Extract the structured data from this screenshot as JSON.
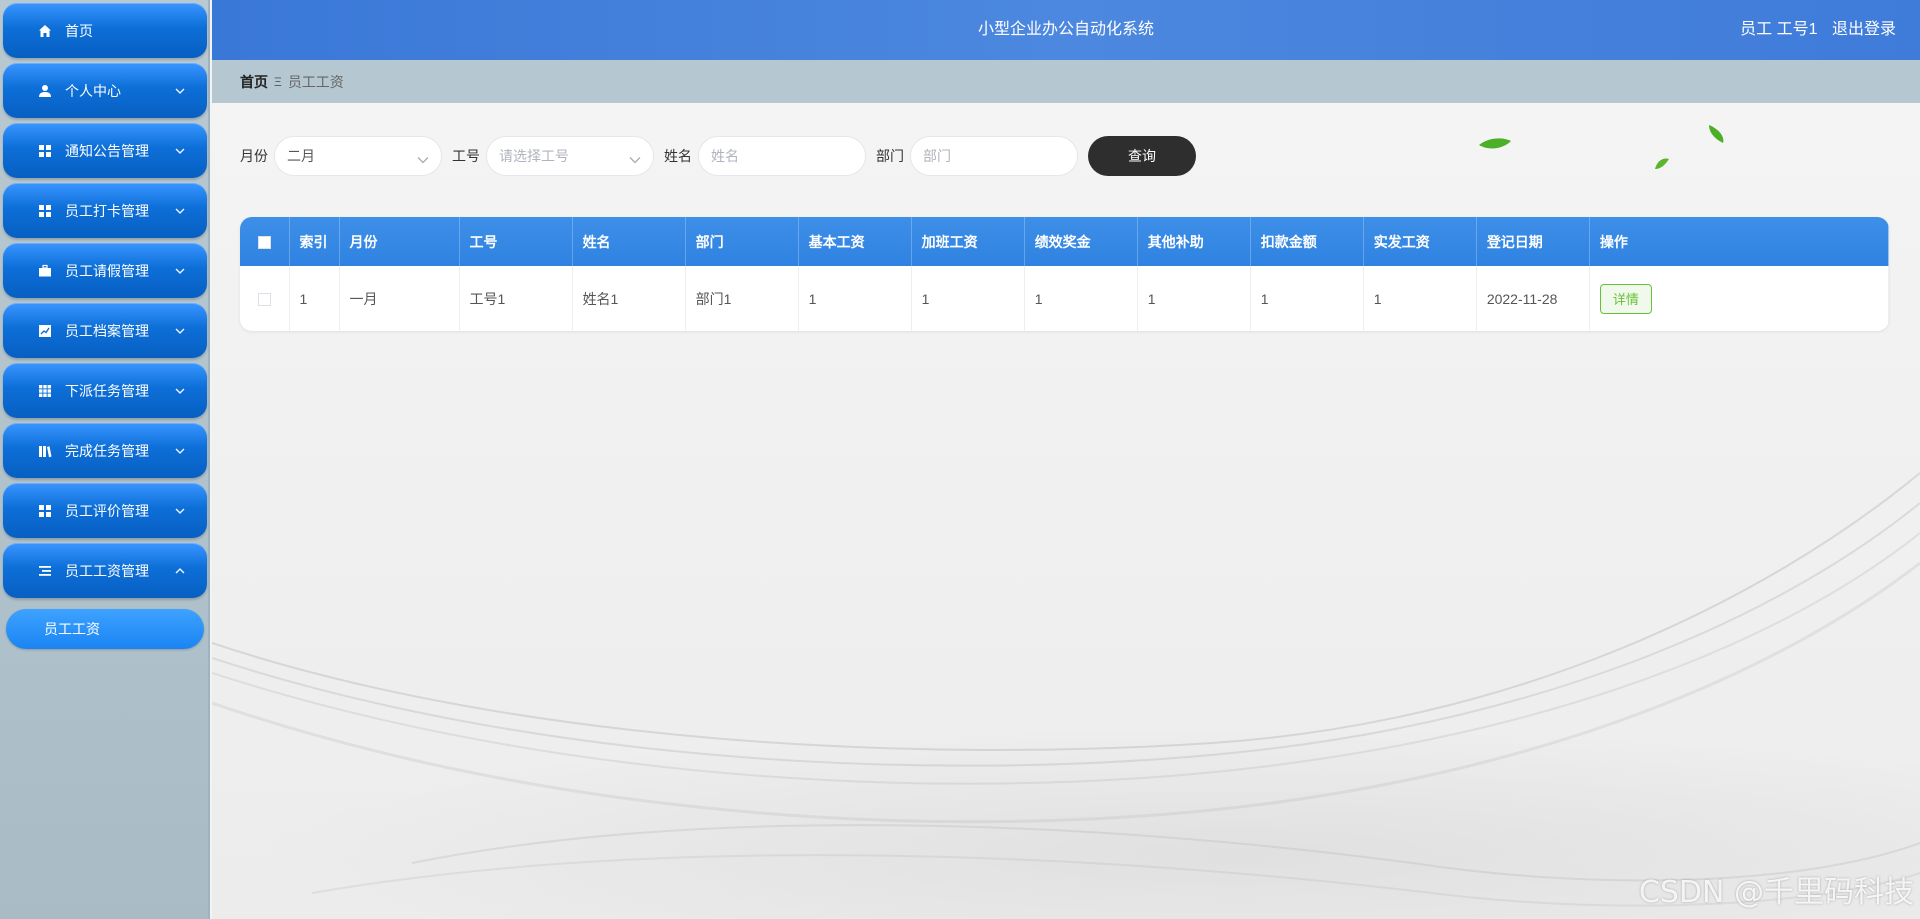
{
  "header": {
    "title": "小型企业办公自动化系统",
    "user": "员工 工号1",
    "logout": "退出登录"
  },
  "sidebar": {
    "items": [
      {
        "label": "首页",
        "icon": "home-icon",
        "expandable": false
      },
      {
        "label": "个人中心",
        "icon": "user-icon",
        "expandable": true
      },
      {
        "label": "通知公告管理",
        "icon": "grid-icon",
        "expandable": true
      },
      {
        "label": "员工打卡管理",
        "icon": "grid-icon",
        "expandable": true
      },
      {
        "label": "员工请假管理",
        "icon": "briefcase-icon",
        "expandable": true
      },
      {
        "label": "员工档案管理",
        "icon": "chart-icon",
        "expandable": true
      },
      {
        "label": "下派任务管理",
        "icon": "table-icon",
        "expandable": true
      },
      {
        "label": "完成任务管理",
        "icon": "library-icon",
        "expandable": true
      },
      {
        "label": "员工评价管理",
        "icon": "grid-icon",
        "expandable": true
      },
      {
        "label": "员工工资管理",
        "icon": "list-icon",
        "expandable": true,
        "expanded": true
      }
    ],
    "submenu": {
      "label": "员工工资"
    }
  },
  "breadcrumb": {
    "home": "首页",
    "separator": "Ξ",
    "current": "员工工资"
  },
  "search": {
    "month_label": "月份",
    "month_value": "二月",
    "empno_label": "工号",
    "empno_placeholder": "请选择工号",
    "name_label": "姓名",
    "name_placeholder": "姓名",
    "dept_label": "部门",
    "dept_placeholder": "部门",
    "button": "查询"
  },
  "table": {
    "columns": [
      "索引",
      "月份",
      "工号",
      "姓名",
      "部门",
      "基本工资",
      "加班工资",
      "绩效奖金",
      "其他补助",
      "扣款金额",
      "实发工资",
      "登记日期",
      "操作"
    ],
    "rows": [
      {
        "index": "1",
        "month": "一月",
        "empno": "工号1",
        "name": "姓名1",
        "dept": "部门1",
        "base": "1",
        "overtime": "1",
        "bonus": "1",
        "allowance": "1",
        "deduction": "1",
        "net": "1",
        "date": "2022-11-28",
        "action": "详情"
      }
    ]
  },
  "watermark": "CSDN @千里码科技",
  "colors": {
    "menu_blue": "#0d6fd8",
    "header_blue": "#3f7bd9",
    "table_header": "#2f82e0",
    "detail_green": "#67c23a",
    "search_button": "#2e2e2e"
  }
}
